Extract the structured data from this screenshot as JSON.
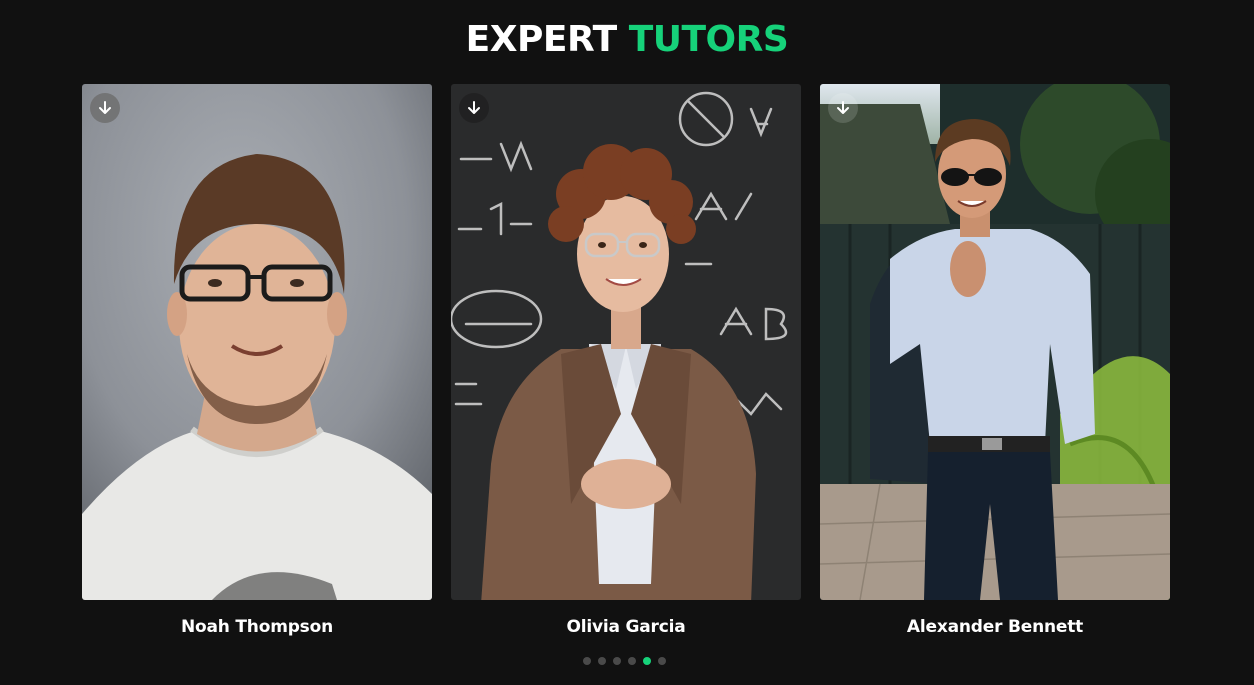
{
  "heading": {
    "part1": "EXPERT",
    "part2": "TUTORS"
  },
  "colors": {
    "background": "#111111",
    "accent": "#16d27a",
    "text": "#ffffff"
  },
  "tutors": [
    {
      "name": "Noah Thompson",
      "icon": "download-arrow-icon"
    },
    {
      "name": "Olivia Garcia",
      "icon": "download-arrow-icon"
    },
    {
      "name": "Alexander Bennett",
      "icon": "download-arrow-icon"
    }
  ],
  "carousel": {
    "total_dots": 6,
    "active_index": 4
  }
}
